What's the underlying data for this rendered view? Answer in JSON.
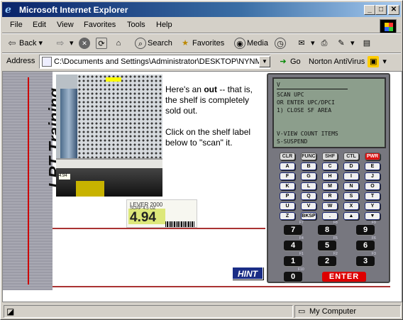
{
  "window": {
    "title": "Microsoft Internet Explorer"
  },
  "menu": [
    "File",
    "Edit",
    "View",
    "Favorites",
    "Tools",
    "Help"
  ],
  "toolbar": {
    "back": "Back",
    "search": "Search",
    "favorites": "Favorites",
    "media": "Media"
  },
  "address": {
    "label": "Address",
    "value": "C:\\Documents and Settings\\Administrator\\DESKTOP\\NYNMA",
    "go": "Go",
    "antivirus": "Norton AntiVirus"
  },
  "content": {
    "sidebar_title": "LRT Training",
    "msg_pre": "Here's an ",
    "msg_bold": "out",
    "msg_post": " -- that is, the shelf is completely sold out.",
    "msg2": "Click on the shelf label below to \"scan\" it.",
    "shelf_tag": "4.94",
    "label": {
      "name": "LEVER 2000",
      "sub": "SOAP 4.5 OZ",
      "price": "4.94"
    },
    "hint": "HINT"
  },
  "device": {
    "screen": [
      "V",
      "SCAN UPC",
      "OR ENTER UPC/DPCI",
      "1) CLOSE SF AREA",
      "",
      "",
      "V-VIEW COUNT ITEMS",
      "S-SUSPEND"
    ],
    "func_keys": [
      "CLR",
      "FUNC",
      "SHF",
      "CTL",
      "PWR"
    ],
    "letters": [
      "A",
      "B",
      "C",
      "D",
      "E",
      "F",
      "G",
      "H",
      "I",
      "J",
      "K",
      "L",
      "M",
      "N",
      "O",
      "P",
      "Q",
      "R",
      "S",
      "T",
      "U",
      "V",
      "W",
      "X",
      "Y",
      "Z"
    ],
    "bksp": "BKSP",
    "dot": ".",
    "num_sub": {
      "f1": "F1",
      "f2": "F2",
      "f3": "F3",
      "f4": "F4",
      "f5": "F5",
      "f6": "F6",
      "f7": "F7",
      "f8": "F8",
      "f9": "F9",
      "f10": "F10"
    },
    "numbers": [
      "7",
      "8",
      "9",
      "4",
      "5",
      "6",
      "1",
      "2",
      "3",
      "0"
    ],
    "enter": "ENTER"
  },
  "status": {
    "zone": "My Computer"
  }
}
